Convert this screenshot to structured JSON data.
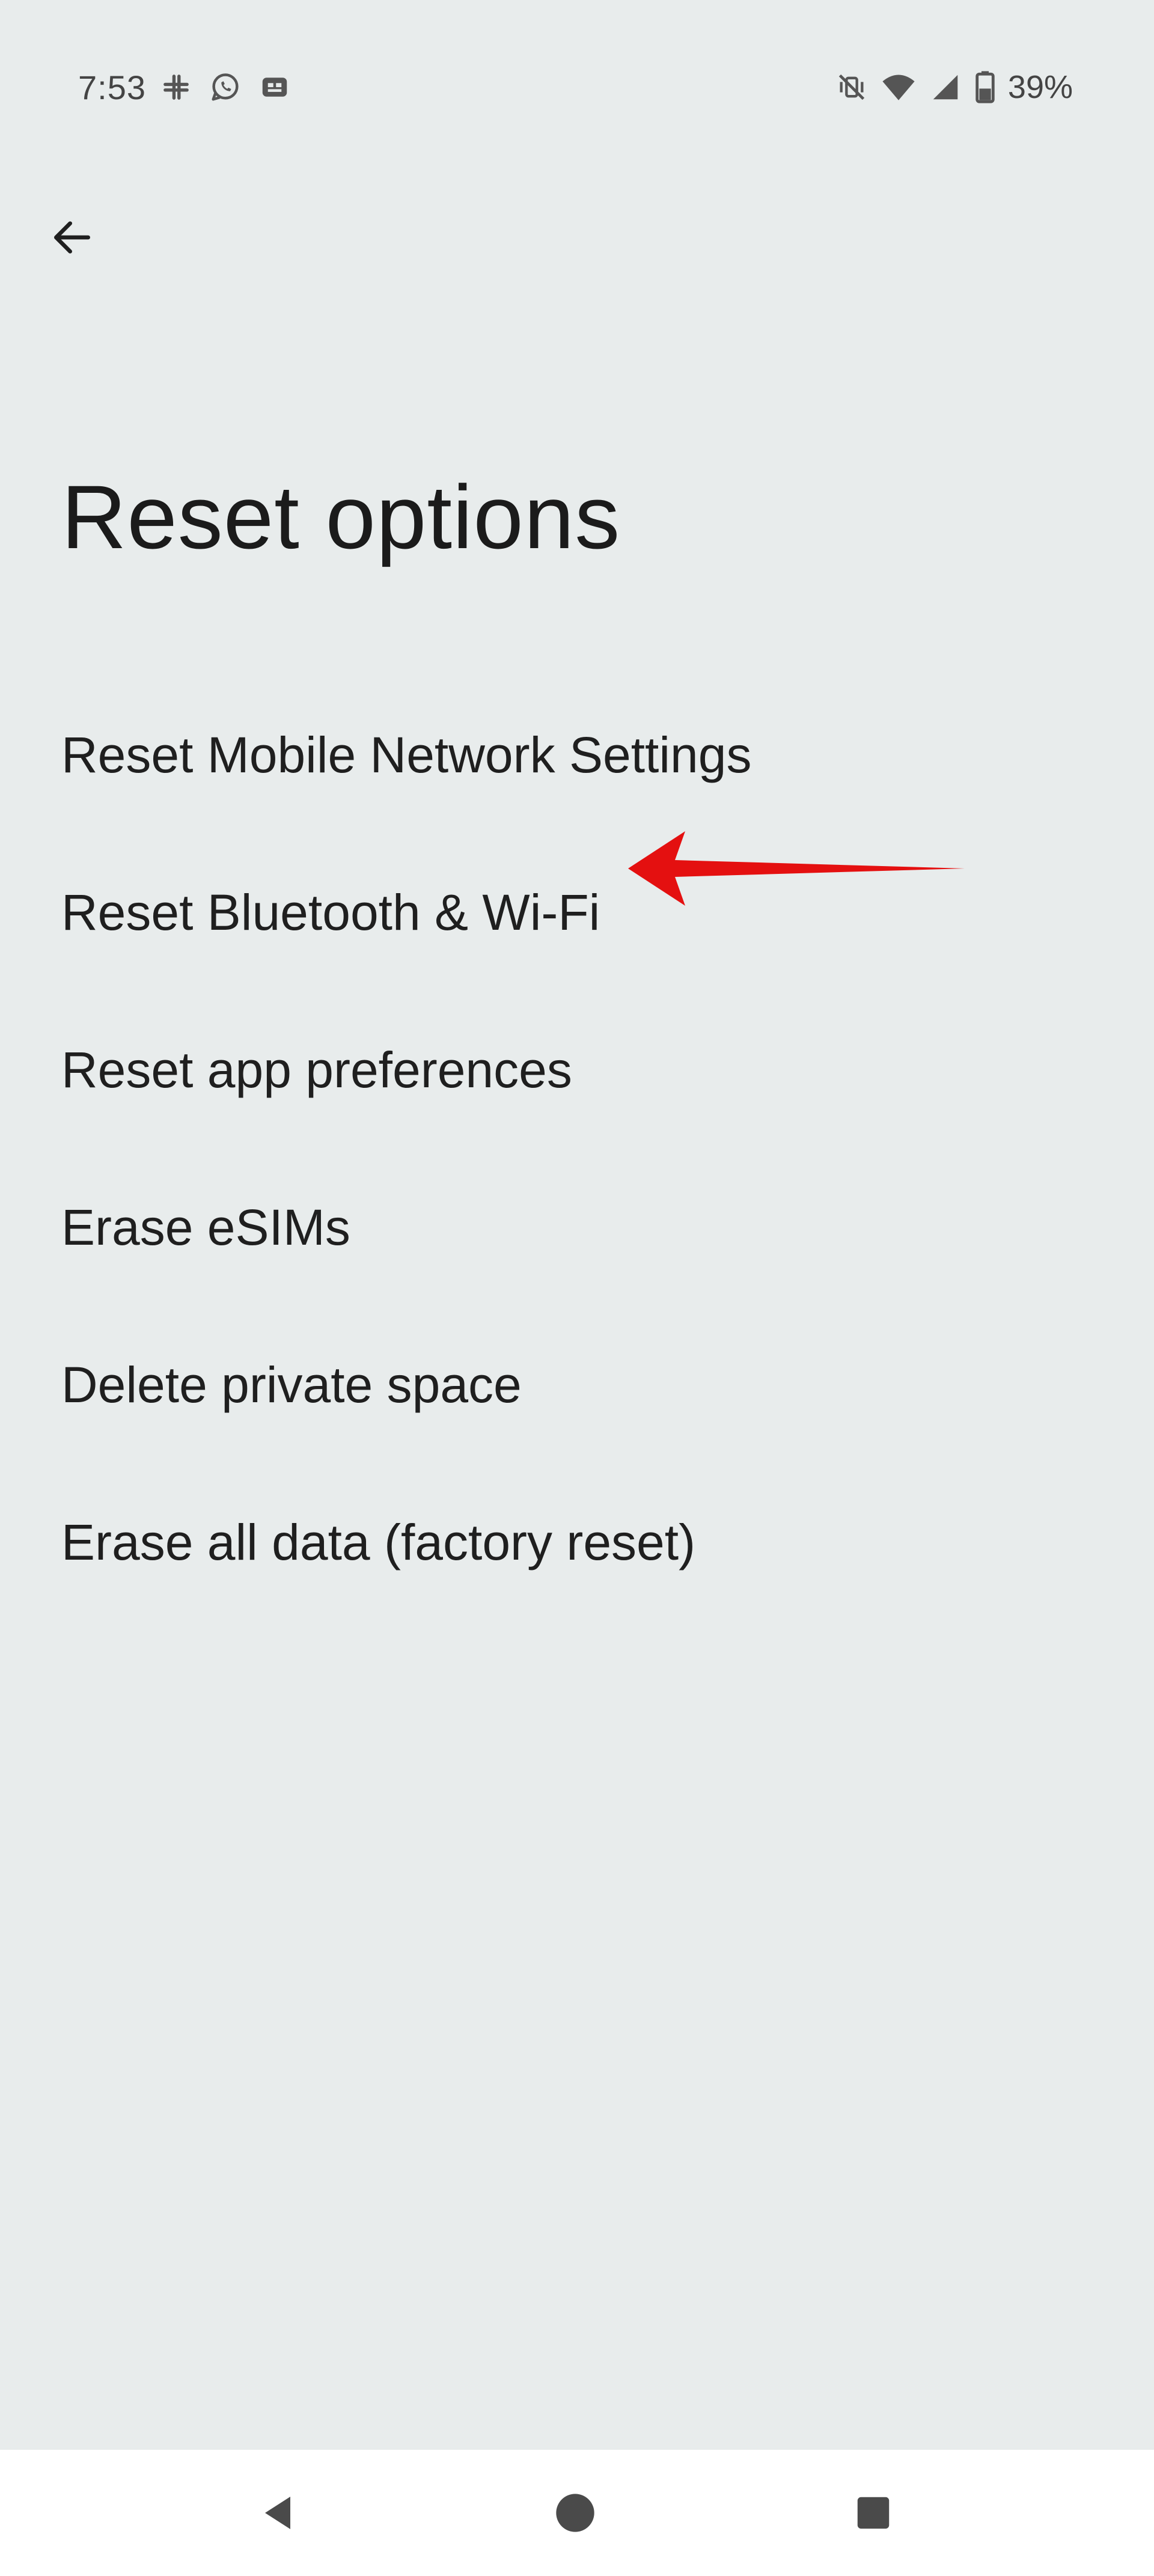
{
  "status_bar": {
    "time": "7:53",
    "left_icons": [
      "slack-icon",
      "whatsapp-icon",
      "app-icon"
    ],
    "right_icons": [
      "vibrate-off-icon",
      "wifi-icon",
      "signal-icon",
      "battery-icon"
    ],
    "battery_percent": "39%"
  },
  "header": {
    "back_icon": "arrow-left-icon"
  },
  "page": {
    "title": "Reset options"
  },
  "options": [
    {
      "label": "Reset Mobile Network Settings"
    },
    {
      "label": "Reset Bluetooth & Wi-Fi"
    },
    {
      "label": "Reset app preferences"
    },
    {
      "label": "Erase eSIMs"
    },
    {
      "label": "Delete private space"
    },
    {
      "label": "Erase all data (factory reset)"
    }
  ],
  "annotation": {
    "color": "#e41010",
    "points_to": "Reset Bluetooth & Wi-Fi"
  },
  "nav_bar": {
    "buttons": [
      "back-triangle-icon",
      "home-circle-icon",
      "recents-square-icon"
    ]
  },
  "colors": {
    "background": "#e8ecec",
    "nav_background": "#ffffff",
    "text": "#1f1f1f"
  }
}
